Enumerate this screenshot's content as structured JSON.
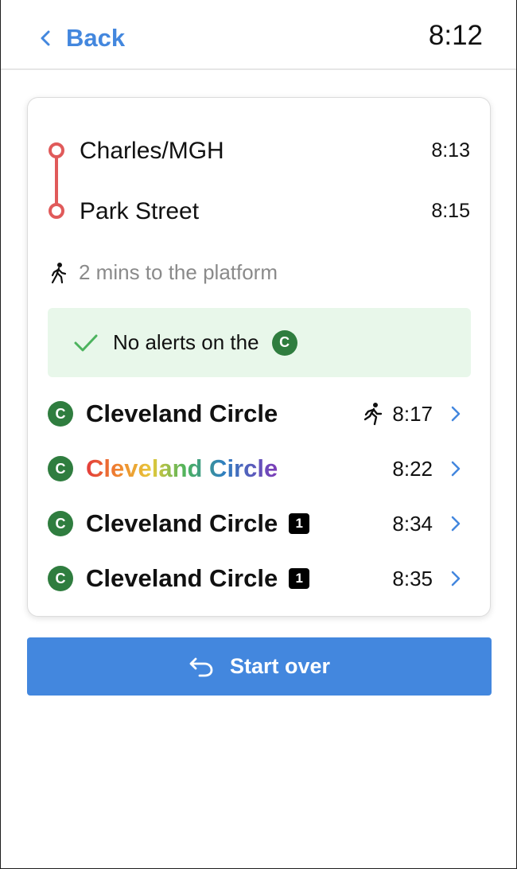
{
  "header": {
    "back_label": "Back",
    "clock": "8:12"
  },
  "trip": {
    "line_color": "#e05a5a",
    "origin": {
      "name": "Charles/MGH",
      "time": "8:13"
    },
    "destination": {
      "name": "Park Street",
      "time": "8:15"
    },
    "walk_text": "2 mins to the platform"
  },
  "alert": {
    "text": "No alerts on the",
    "line_badge": "C",
    "check_icon": "check-icon",
    "background": "#e8f7ea"
  },
  "departures": [
    {
      "line_badge": "C",
      "destination": "Cleveland Circle",
      "time": "8:17",
      "style": "normal",
      "car_badge": "",
      "running_icon": true
    },
    {
      "line_badge": "C",
      "destination": "Cleveland Circle",
      "time": "8:22",
      "style": "rainbow",
      "car_badge": "",
      "running_icon": false
    },
    {
      "line_badge": "C",
      "destination": "Cleveland Circle",
      "time": "8:34",
      "style": "normal",
      "car_badge": "1",
      "running_icon": false
    },
    {
      "line_badge": "C",
      "destination": "Cleveland Circle",
      "time": "8:35",
      "style": "normal",
      "car_badge": "1",
      "running_icon": false
    }
  ],
  "actions": {
    "start_over_label": "Start over"
  },
  "colors": {
    "accent": "#4387de",
    "green_line": "#2f7d3f",
    "text": "#111111",
    "muted": "#8a8a8a"
  }
}
